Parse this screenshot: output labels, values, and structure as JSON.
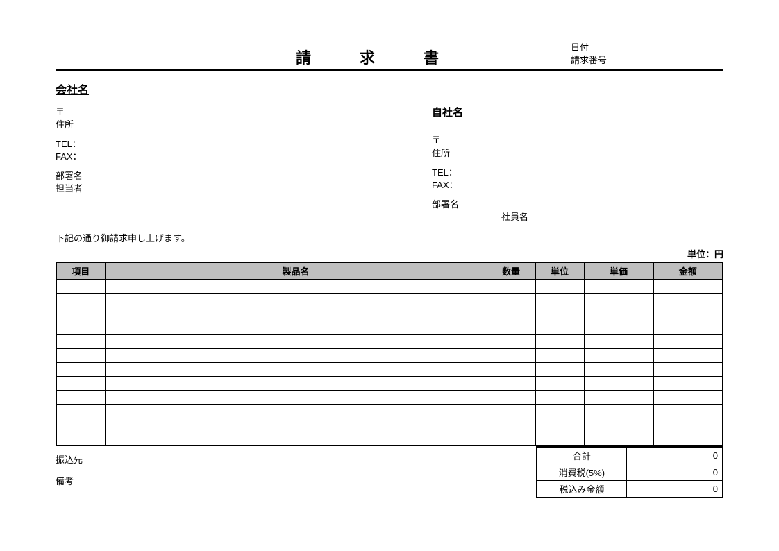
{
  "header": {
    "title": "請　求　書",
    "date_label": "日付",
    "invoice_no_label": "請求番号"
  },
  "client": {
    "company_label": "会社名",
    "postal": "〒",
    "address": "住所",
    "tel": "TEL：",
    "fax": "FAX：",
    "department": "部署名",
    "person": "担当者"
  },
  "self": {
    "company_label": "自社名",
    "postal": "〒",
    "address": "住所",
    "tel": "TEL：",
    "fax": "FAX：",
    "department": "部署名",
    "employee": "社員名"
  },
  "message": "下記の通り御請求申し上げます。",
  "unit_label": "単位：円",
  "table": {
    "headers": {
      "item": "項目",
      "product": "製品名",
      "qty": "数量",
      "unit": "単位",
      "price": "単価",
      "amount": "金額"
    },
    "row_count": 12
  },
  "footer": {
    "transfer_label": "振込先",
    "note_label": "備考"
  },
  "totals": {
    "subtotal_label": "合計",
    "subtotal_value": "0",
    "tax_label": "消費税(5%)",
    "tax_value": "0",
    "grand_label": "税込み金額",
    "grand_value": "0"
  }
}
